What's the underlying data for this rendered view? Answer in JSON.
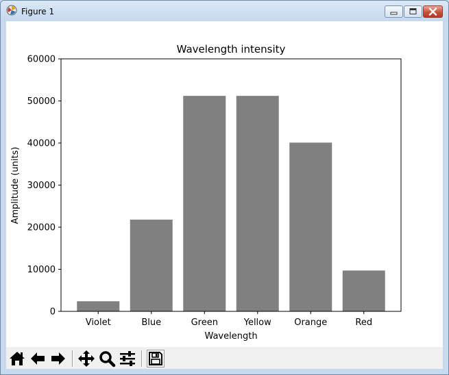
{
  "window": {
    "title": "Figure 1"
  },
  "toolbar": {
    "buttons": [
      {
        "name": "home-icon",
        "tooltip": "Home"
      },
      {
        "name": "back-arrow-icon",
        "tooltip": "Back"
      },
      {
        "name": "forward-arrow-icon",
        "tooltip": "Forward"
      },
      {
        "name": "pan-icon",
        "tooltip": "Pan"
      },
      {
        "name": "zoom-icon",
        "tooltip": "Zoom"
      },
      {
        "name": "subplots-config-icon",
        "tooltip": "Configure subplots"
      },
      {
        "name": "save-icon",
        "tooltip": "Save"
      }
    ]
  },
  "chart_data": {
    "type": "bar",
    "title": "Wavelength intensity",
    "xlabel": "Wavelength",
    "ylabel": "Amplitude (units)",
    "categories": [
      "Violet",
      "Blue",
      "Green",
      "Yellow",
      "Orange",
      "Red"
    ],
    "values": [
      2400,
      21800,
      51200,
      51200,
      40100,
      9700
    ],
    "ylim": [
      0,
      60000
    ],
    "yticks": [
      0,
      10000,
      20000,
      30000,
      40000,
      50000,
      60000
    ],
    "ytick_labels": [
      "0",
      "10000",
      "20000",
      "30000",
      "40000",
      "50000",
      "60000"
    ],
    "bar_color": "#808080",
    "grid": false,
    "legend": "none"
  }
}
